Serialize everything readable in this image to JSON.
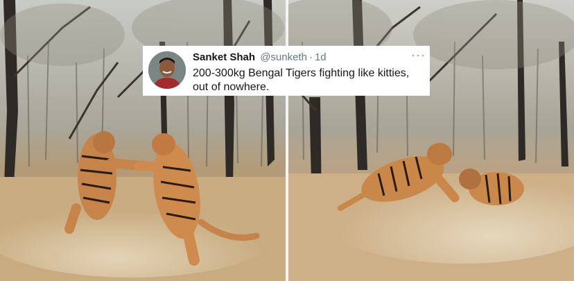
{
  "tweet": {
    "author_name": "Sanket Shah",
    "handle": "@sunketh",
    "separator": "·",
    "time": "1d",
    "text": "200-300kg Bengal Tigers fighting like kitties, out of nowhere.",
    "more_icon": "ellipsis-icon"
  },
  "photos": [
    {
      "scene": "two tigers standing on hind legs, pawing at each other in dry forest"
    },
    {
      "scene": "two tigers tumbling and wrestling on dusty ground in dry forest"
    }
  ]
}
